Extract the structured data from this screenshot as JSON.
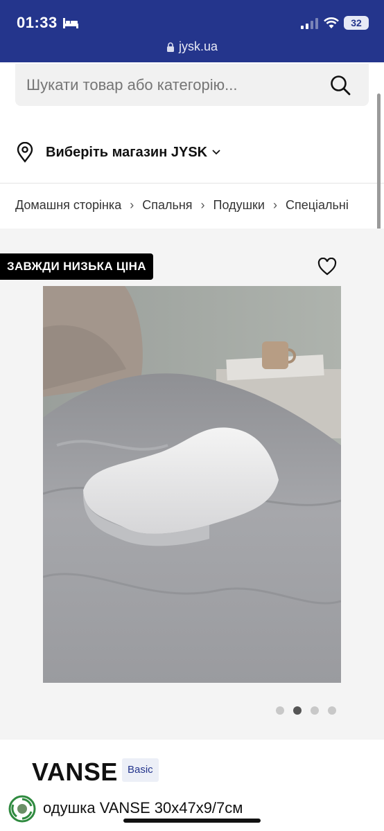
{
  "status_bar": {
    "time": "01:33",
    "battery": "32",
    "url": "jysk.ua",
    "icons": [
      "bed-icon",
      "signal-icon",
      "wifi-icon",
      "lock-icon"
    ]
  },
  "search": {
    "placeholder": "Шукати товар або категорію..."
  },
  "store": {
    "label": "Виберіть магазин JYSK"
  },
  "breadcrumb": {
    "items": [
      "Домашня сторінка",
      "Спальня",
      "Подушки",
      "Спеціальні"
    ]
  },
  "product": {
    "badge": "ЗАВЖДИ НИЗЬКА ЦІНА",
    "title": "VANSE",
    "tag": "Basic",
    "subtitle": "одушка VANSE 30x47x9/7см",
    "gallery_active_index": 1,
    "gallery_count": 4
  },
  "colors": {
    "brand": "#24358c",
    "badge_bg": "#000000"
  }
}
